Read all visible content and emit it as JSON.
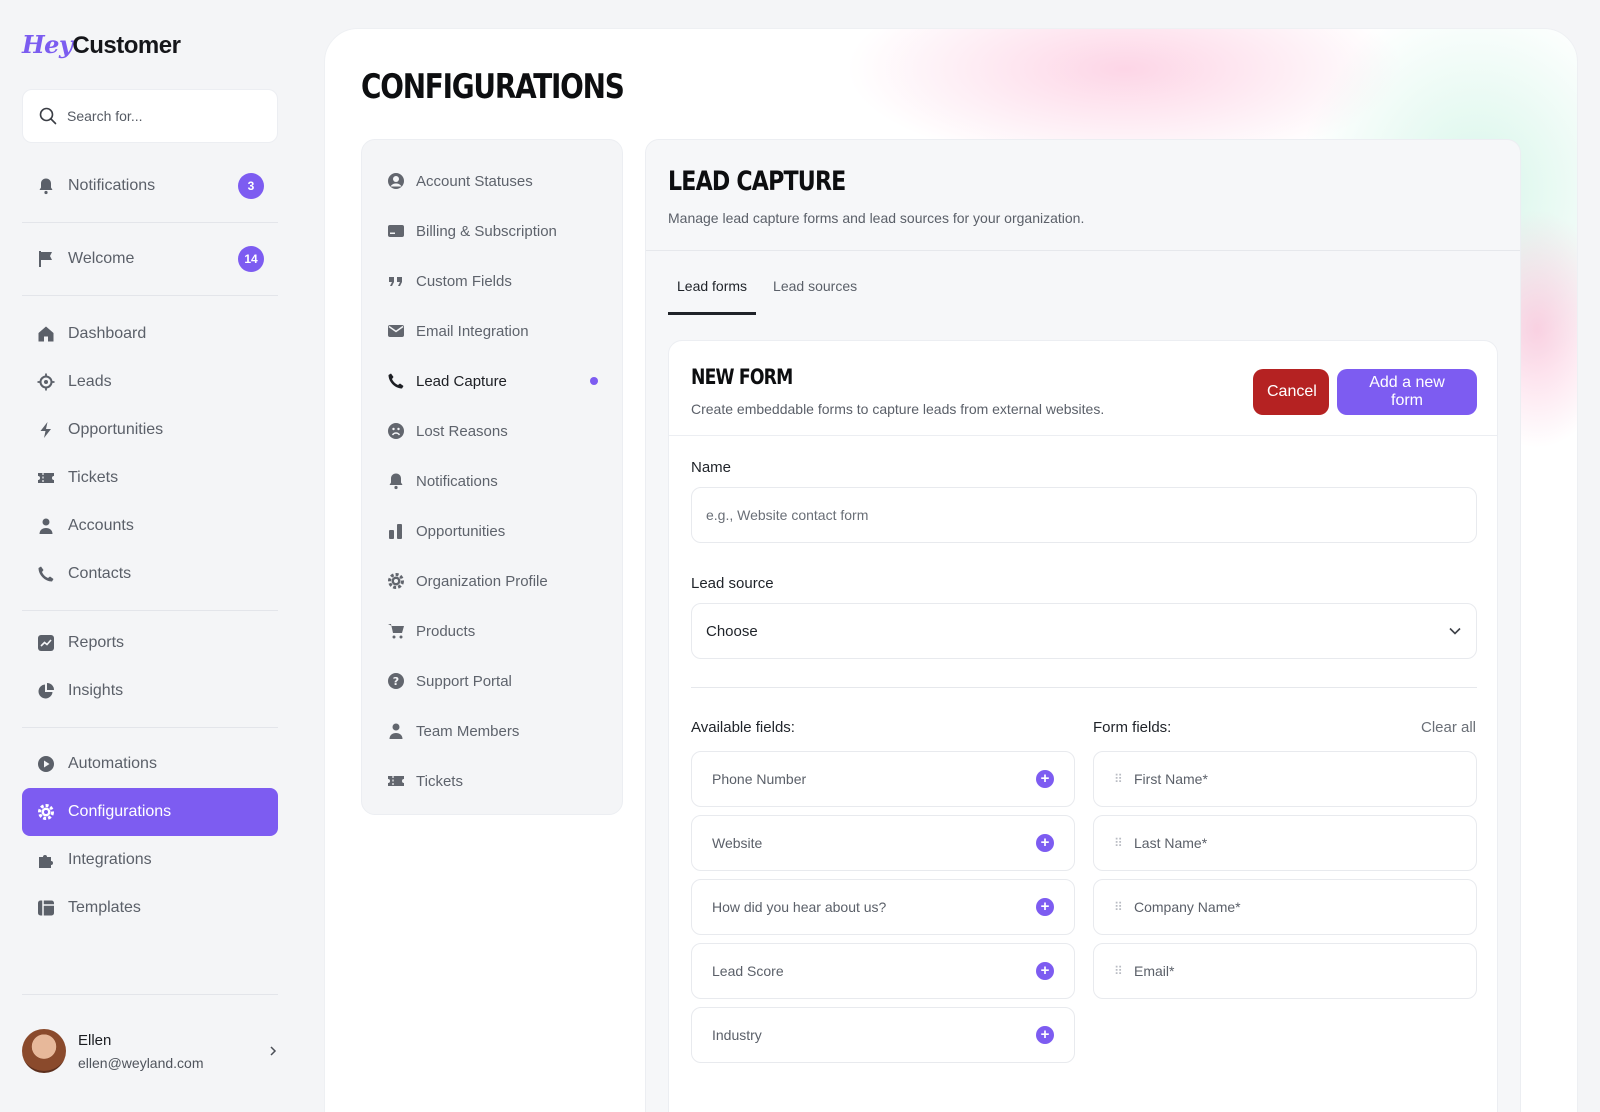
{
  "brand": {
    "hey": "Hey",
    "customer": "Customer"
  },
  "search": {
    "placeholder": "Search for..."
  },
  "sidebar": {
    "top": [
      {
        "label": "Notifications",
        "badge": "3",
        "icon": "bell-icon"
      },
      {
        "label": "Welcome",
        "badge": "14",
        "icon": "flag-icon"
      }
    ],
    "main": [
      {
        "label": "Dashboard",
        "icon": "home-icon"
      },
      {
        "label": "Leads",
        "icon": "target-icon"
      },
      {
        "label": "Opportunities",
        "icon": "bolt-icon"
      },
      {
        "label": "Tickets",
        "icon": "ticket-icon"
      },
      {
        "label": "Accounts",
        "icon": "user-icon"
      },
      {
        "label": "Contacts",
        "icon": "phone-icon"
      }
    ],
    "reports": [
      {
        "label": "Reports",
        "icon": "chart-icon"
      },
      {
        "label": "Insights",
        "icon": "pie-icon"
      }
    ],
    "settings": [
      {
        "label": "Automations",
        "icon": "play-icon"
      },
      {
        "label": "Configurations",
        "icon": "gear-icon",
        "active": true
      },
      {
        "label": "Integrations",
        "icon": "puzzle-icon"
      },
      {
        "label": "Templates",
        "icon": "template-icon"
      }
    ]
  },
  "user": {
    "name": "Ellen",
    "email": "ellen@weyland.com"
  },
  "page": {
    "title": "CONFIGURATIONS"
  },
  "config_nav": [
    {
      "label": "Account Statuses",
      "icon": "user-circle-icon"
    },
    {
      "label": "Billing & Subscription",
      "icon": "card-icon"
    },
    {
      "label": "Custom Fields",
      "icon": "quote-icon"
    },
    {
      "label": "Email Integration",
      "icon": "mail-icon"
    },
    {
      "label": "Lead Capture",
      "icon": "phone-icon",
      "current": true
    },
    {
      "label": "Lost Reasons",
      "icon": "sad-face-icon"
    },
    {
      "label": "Notifications",
      "icon": "bell-icon"
    },
    {
      "label": "Opportunities",
      "icon": "bars-icon"
    },
    {
      "label": "Organization Profile",
      "icon": "gear-icon"
    },
    {
      "label": "Products",
      "icon": "cart-icon"
    },
    {
      "label": "Support Portal",
      "icon": "help-icon"
    },
    {
      "label": "Team Members",
      "icon": "user-icon"
    },
    {
      "label": "Tickets",
      "icon": "ticket-icon"
    }
  ],
  "section": {
    "title": "LEAD CAPTURE",
    "subtitle": "Manage lead capture forms and lead sources for your organization.",
    "tabs": [
      {
        "label": "Lead forms",
        "active": true
      },
      {
        "label": "Lead sources"
      }
    ]
  },
  "form": {
    "title": "NEW FORM",
    "subtitle": "Create embeddable forms to capture leads from external websites.",
    "cancel_label": "Cancel",
    "add_label": "Add a new form",
    "name_label": "Name",
    "name_placeholder": "e.g., Website contact form",
    "source_label": "Lead source",
    "source_value": "Choose",
    "available_label": "Available fields:",
    "form_fields_label": "Form fields:",
    "clear_all": "Clear all",
    "available_fields": [
      "Phone Number",
      "Website",
      "How did you hear about us?",
      "Lead Score",
      "Industry"
    ],
    "form_fields": [
      "First Name*",
      "Last Name*",
      "Company Name*",
      "Email*"
    ]
  },
  "colors": {
    "accent": "#7d5cf1",
    "danger": "#b52222"
  }
}
